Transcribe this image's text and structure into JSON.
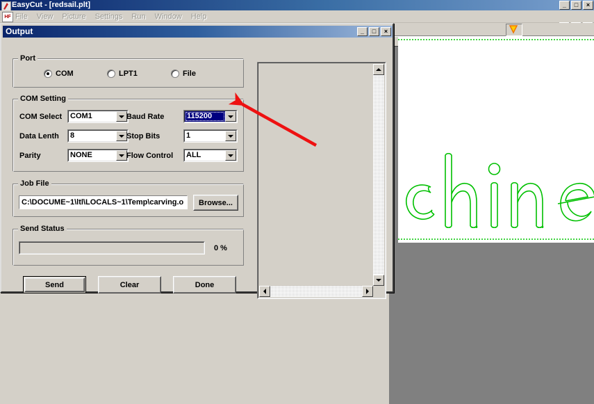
{
  "app": {
    "title": "EasyCut - [redsail.plt]",
    "title_icon": "app-logo-icon",
    "mdi_icon_text": "HF",
    "menu": [
      {
        "label": "File"
      },
      {
        "label": "View"
      },
      {
        "label": "Picture"
      },
      {
        "label": "Settings"
      },
      {
        "label": "Run"
      },
      {
        "label": "Window"
      },
      {
        "label": "Help"
      }
    ],
    "window_buttons": [
      {
        "label": "_",
        "name": "minimize"
      },
      {
        "label": "□",
        "name": "restore"
      },
      {
        "label": "×",
        "name": "close"
      }
    ],
    "mdi_window_buttons": [
      {
        "label": "_",
        "name": "minimize"
      },
      {
        "label": "□",
        "name": "restore"
      },
      {
        "label": "×",
        "name": "close"
      }
    ]
  },
  "canvas": {
    "artwork_text": "chine",
    "artwork_color": "#00c000",
    "boundary_color": "#3fd43f",
    "page_color": "#ffffff",
    "workspace_color": "#808080",
    "toolbar_icon": "chevron-down-icon",
    "toolbar_icon_color": "#ff9900"
  },
  "dialog": {
    "title": "Output",
    "window_buttons": [
      {
        "label": "_",
        "name": "minimize"
      },
      {
        "label": "□",
        "name": "maximize"
      },
      {
        "label": "×",
        "name": "close"
      }
    ],
    "port": {
      "legend": "Port",
      "options": [
        {
          "label": "COM",
          "checked": true
        },
        {
          "label": "LPT1",
          "checked": false
        },
        {
          "label": "File",
          "checked": false
        }
      ]
    },
    "com_setting": {
      "legend": "COM Setting",
      "fields": [
        {
          "label": "COM Select",
          "value": "COM1",
          "selected": false
        },
        {
          "label": "Baud Rate",
          "value": "115200",
          "selected": true
        },
        {
          "label": "Data Lenth",
          "value": "8",
          "selected": false
        },
        {
          "label": "Stop Bits",
          "value": "1",
          "selected": false
        },
        {
          "label": "Parity",
          "value": "NONE",
          "selected": false
        },
        {
          "label": "Flow Control",
          "value": "ALL",
          "selected": false
        }
      ]
    },
    "job_file": {
      "legend": "Job File",
      "path": "C:\\DOCUME~1\\ltl\\LOCALS~1\\Temp\\carving.o",
      "browse_label": "Browse..."
    },
    "send_status": {
      "legend": "Send Status",
      "percent_label": "0 %",
      "percent_value": 0
    },
    "buttons": [
      {
        "label": "Send",
        "default": true
      },
      {
        "label": "Clear",
        "default": false
      },
      {
        "label": "Done",
        "default": false
      }
    ],
    "log_panel": {
      "content": "",
      "scroll_up": "scroll-up-arrow",
      "scroll_down": "scroll-down-arrow",
      "scroll_left": "scroll-left-arrow",
      "scroll_right": "scroll-right-arrow"
    }
  },
  "annotation": {
    "arrow_color": "#ee1111",
    "points_to": "Baud Rate dropdown"
  }
}
